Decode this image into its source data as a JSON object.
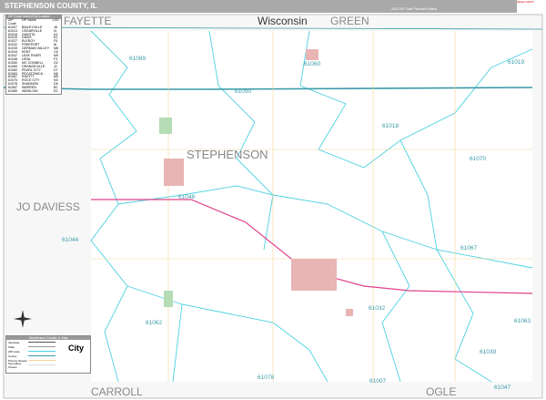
{
  "header": {
    "title": "STEPHENSON COUNTY, IL",
    "edition": "2020 ZIP Code Premium Edition",
    "logo_text": "Market MAPS"
  },
  "map": {
    "county_label": "STEPHENSON",
    "neighbors": [
      "FAYETTE",
      "Wisconsin",
      "GREEN",
      "JO DAVIESS",
      "CARROLL",
      "OGLE"
    ],
    "zip_labels": [
      "61089",
      "61060",
      "61019",
      "61050",
      "61018",
      "61070",
      "61048",
      "61044",
      "61067",
      "61032",
      "61062",
      "61063",
      "61039",
      "61078",
      "61007",
      "61047"
    ],
    "colors": {
      "zip_boundary": "#4dd0e1",
      "county_boundary": "#3a9aa8",
      "highway": "#e0408a",
      "city": "#e8b4b4",
      "road": "#f3d59a"
    }
  },
  "zip_table": {
    "title": "ZIP Code Index/Grid Locator",
    "headers": [
      "ZIP Code",
      "ZIP Name",
      "LOC"
    ],
    "rows": [
      [
        "61007",
        "BAILEYVILLE",
        "J8"
      ],
      [
        "61013",
        "CEDARVILLE",
        "I4"
      ],
      [
        "61018",
        "DAKOTA",
        "K3"
      ],
      [
        "61019",
        "DAVIS",
        "K2"
      ],
      [
        "61027",
        "ELEROY",
        "F5"
      ],
      [
        "61032",
        "FREEPORT",
        "I6"
      ],
      [
        "61039",
        "GERMAN VALLEY",
        "M8"
      ],
      [
        "61044",
        "KENT",
        "C6"
      ],
      [
        "61047",
        "LEAF RIVER",
        "M9"
      ],
      [
        "61048",
        "LENA",
        "F4"
      ],
      [
        "61050",
        "MC CONNELL",
        "G2"
      ],
      [
        "61060",
        "ORANGEVILLE",
        "J2"
      ],
      [
        "61062",
        "PEARL CITY",
        "D7"
      ],
      [
        "61063",
        "PECATONICA",
        "N6"
      ],
      [
        "61067",
        "RIDOTT",
        "M5"
      ],
      [
        "61070",
        "ROCK CITY",
        "N3"
      ],
      [
        "61078",
        "SHANNON",
        "D8"
      ],
      [
        "61087",
        "WARREN",
        "B2"
      ],
      [
        "61089",
        "WINSLOW",
        "E2"
      ]
    ]
  },
  "legend": {
    "title": "Stephenson County, IL Map",
    "items": [
      "Interstate",
      "State",
      "ZIP Code",
      "County",
      "Primary Streets",
      "Secondary Streets"
    ],
    "city_label": "City"
  }
}
